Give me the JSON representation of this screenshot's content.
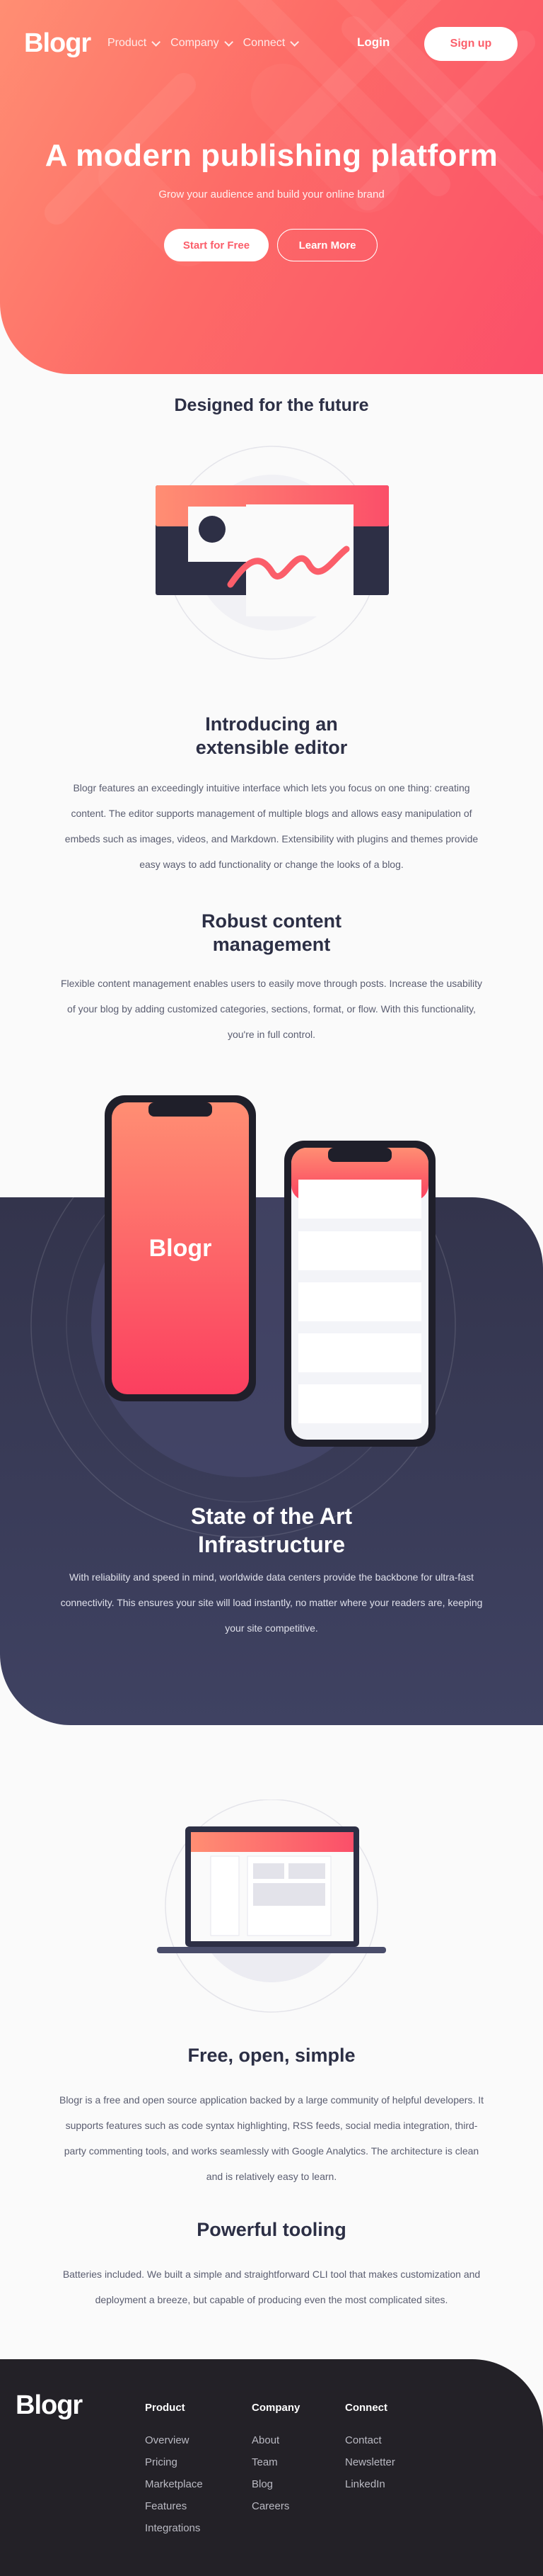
{
  "header": {
    "logo": "Blogr",
    "nav": [
      {
        "label": "Product"
      },
      {
        "label": "Company"
      },
      {
        "label": "Connect"
      }
    ],
    "login": "Login",
    "signup": "Sign up"
  },
  "hero": {
    "title": "A modern publishing platform",
    "subtitle": "Grow your audience and build your online brand",
    "primary_cta": "Start for Free",
    "secondary_cta": "Learn More"
  },
  "future": {
    "heading": "Designed for the future",
    "features": [
      {
        "title_line1": "Introducing an",
        "title_line2": "extensible editor",
        "text_lines": [
          "Blogr features an exceedingly intuitive interface which lets you focus on one thing: creating",
          "content. The editor supports management of multiple blogs and allows easy manipulation of",
          "embeds such as images, videos, and Markdown. Extensibility with plugins and themes provide",
          "easy ways to add functionality or change the looks of a blog."
        ]
      },
      {
        "title_line1": "Robust content",
        "title_line2": "management",
        "text_lines": [
          "Flexible content management enables users to easily move through posts. Increase the usability",
          "of your blog by adding customized categories, sections, format, or flow. With this functionality,",
          "you're in full control."
        ]
      }
    ]
  },
  "phones": {
    "brand": "Blogr"
  },
  "infrastructure": {
    "title_line1": "State of the Art",
    "title_line2": "Infrastructure",
    "text_lines": [
      "With reliability and speed in mind, worldwide data centers provide the backbone for ultra-fast",
      "connectivity. This ensures your site will load instantly, no matter where your readers are, keeping",
      "your site competitive."
    ]
  },
  "simple": {
    "title": "Free, open, simple",
    "text_lines": [
      "Blogr is a free and open source application backed by a large community of helpful developers. It",
      "supports features such as code syntax highlighting, RSS feeds, social media integration, third-",
      "party commenting tools, and works seamlessly with Google Analytics. The architecture is clean",
      "and is relatively easy to learn."
    ]
  },
  "tooling": {
    "title": "Powerful tooling",
    "text_lines": [
      "Batteries included. We built a simple and straightforward CLI tool that makes customization and",
      "deployment a breeze, but capable of producing even the most complicated sites."
    ]
  },
  "footer": {
    "logo": "Blogr",
    "columns": [
      {
        "heading": "Product",
        "links": [
          "Overview",
          "Pricing",
          "Marketplace",
          "Features",
          "Integrations"
        ]
      },
      {
        "heading": "Company",
        "links": [
          "About",
          "Team",
          "Blog",
          "Careers"
        ]
      },
      {
        "heading": "Connect",
        "links": [
          "Contact",
          "Newsletter",
          "LinkedIn"
        ]
      }
    ]
  },
  "colors": {
    "accent": "#fb5e6a",
    "hero_gradient_start": "#ff8e73",
    "hero_gradient_end": "#fb4f69",
    "dark_section": "#3f4262",
    "footer_bg": "#232127"
  }
}
